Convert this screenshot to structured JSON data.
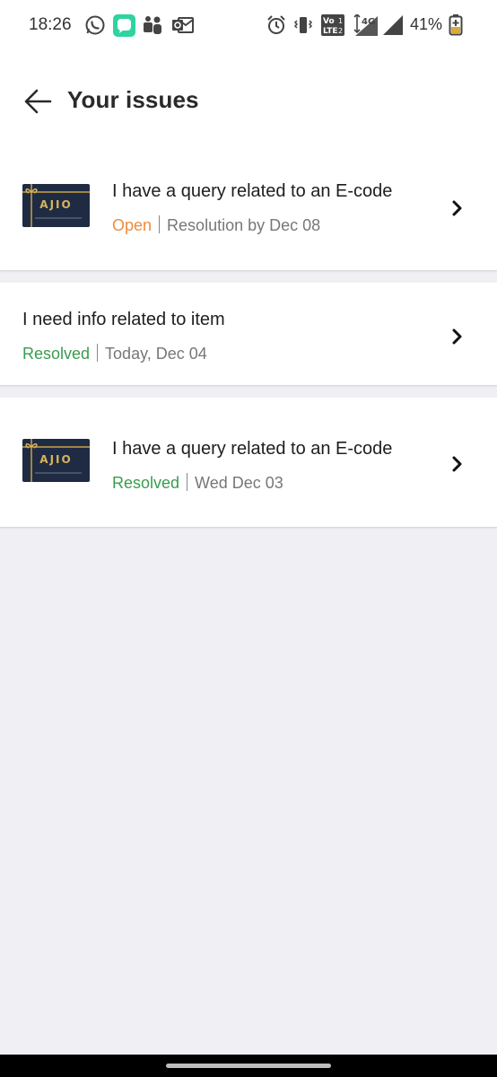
{
  "status_bar": {
    "time": "18:26",
    "battery_percent": "41%",
    "notification_icons": [
      "whatsapp-icon",
      "chat-app-icon",
      "teams-icon",
      "outlook-icon"
    ],
    "system_icons": [
      "alarm-icon",
      "vibrate-icon",
      "volte-icon",
      "network-4g-icon",
      "signal-icon",
      "battery-charging-icon"
    ],
    "network_label": "4G⁺",
    "volte_label": "Vo LTE"
  },
  "header": {
    "title": "Your issues",
    "back_icon": "arrow-left-icon"
  },
  "issues": [
    {
      "title": "I have a query related to an E-code",
      "status": "Open",
      "date": "Resolution by Dec 08",
      "thumbnail_label": "AJIO",
      "has_thumbnail": true
    },
    {
      "title": "I need info related to item",
      "status": "Resolved",
      "date": "Today, Dec 04",
      "has_thumbnail": false
    },
    {
      "title": "I have a query related to an E-code",
      "status": "Resolved",
      "date": "Wed Dec 03",
      "thumbnail_label": "AJIO",
      "has_thumbnail": true
    }
  ],
  "colors": {
    "open": "#ef8c3c",
    "resolved": "#3a9c4e",
    "background": "#f0f0f4",
    "card": "#ffffff",
    "gift_card": "#1f2b43",
    "gold": "#d8b45a"
  }
}
